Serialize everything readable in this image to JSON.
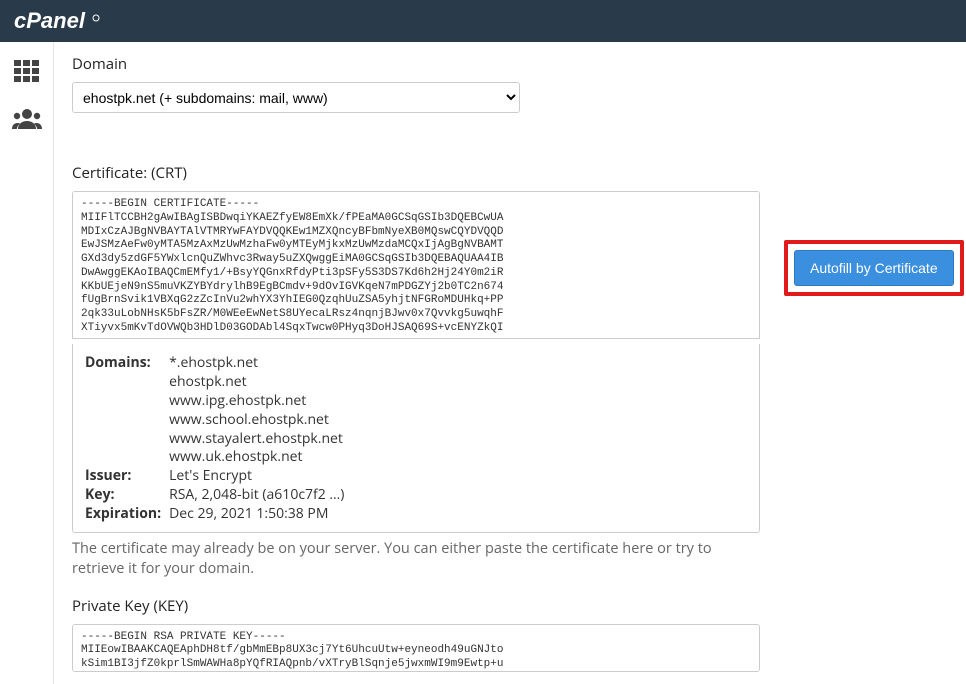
{
  "brand": "cPanel",
  "domain_section": {
    "label": "Domain",
    "selected": "ehostpk.net   (+ subdomains: mail, www)"
  },
  "certificate_section": {
    "label": "Certificate: (CRT)",
    "value": "-----BEGIN CERTIFICATE-----\nMIIFlTCCBH2gAwIBAgISBDwqiYKAEZfyEW8EmXk/fPEaMA0GCSqGSIb3DQEBCwUA\nMDIxCzAJBgNVBAYTAlVTMRYwFAYDVQQKEw1MZXQncyBFbmNyeXB0MQswCQYDVQQD\nEwJSMzAeFw0yMTA5MzAxMzUwMzhaFw0yMTEyMjkxMzUwMzdaMCQxIjAgBgNVBAMT\nGXd3dy5zdGF5YWxlcnQuZWhvc3Rway5uZXQwggEiMA0GCSqGSIb3DQEBAQUAA4IB\nDwAwggEKAoIBAQCmEMfy1/+BsyYQGnxRfdyPti3pSFy5S3DS7Kd6h2Hj24Y0m2iR\nKKbUEjeN9nS5muVKZYBYdrylhB9EgBCmdv+9dOvIGVKqeN7mPDGZYj2b0TC2n674\nfUgBrnSvik1VBXqG2zZcInVu2whYX3YhIEG0QzqhUuZSA5yhjtNFGRoMDUHkq+PP\n2qk33uLobNHsK5bFsZR/M0WEeEwNetS8UYecaLRsz4nqnjBJwv0x7Qvvkg5uwqhF\nXTiyvx5mKvTdOVWQb3HDlD03GODAbl4SqxTwcw0PHyq3DoHJSAQ69S+vcENYZkQI",
    "details": {
      "domains_label": "Domains:",
      "domains": [
        "*.ehostpk.net",
        "ehostpk.net",
        "www.ipg.ehostpk.net",
        "www.school.ehostpk.net",
        "www.stayalert.ehostpk.net",
        "www.uk.ehostpk.net"
      ],
      "issuer_label": "Issuer:",
      "issuer": "Let's Encrypt",
      "key_label": "Key:",
      "key": "RSA, 2,048-bit (a610c7f2 …)",
      "expiration_label": "Expiration:",
      "expiration": "Dec 29, 2021 1:50:38 PM"
    },
    "hint": "The certificate may already be on your server. You can either paste the certificate here or try to retrieve it for your domain.",
    "autofill_label": "Autofill by Certificate"
  },
  "private_key_section": {
    "label": "Private Key (KEY)",
    "value": "-----BEGIN RSA PRIVATE KEY-----\nMIIEowIBAAKCAQEAphDH8tf/gbMmEBp8UX3cj7Yt6UhcuUtw+eyneodh49uGNJto\nkSim1BI3jfZ0kprlSmWAWHa8pYQfRIAQpnb/vXTryBlSqnje5jwxmWI9m9Ewtp+u"
  }
}
